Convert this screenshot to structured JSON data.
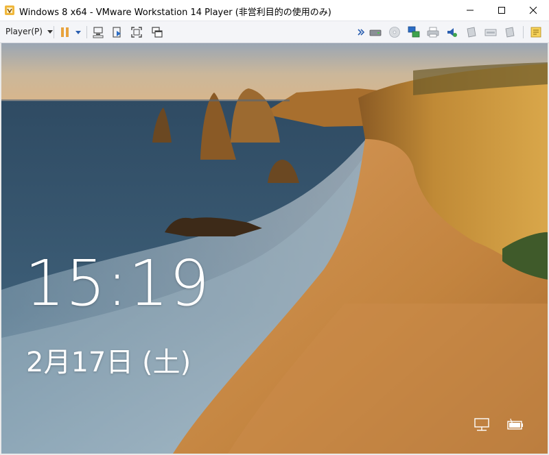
{
  "window": {
    "title": "Windows 8 x64 - VMware Workstation 14 Player (非営利目的の使用のみ)",
    "icon": "vmware-player-icon",
    "controls": [
      "minimize-icon",
      "maximize-icon",
      "close-icon"
    ]
  },
  "toolbar": {
    "player_menu_label": "Player(P)",
    "left_icons": [
      "pause-icon",
      "pause-dropdown-icon",
      "send-ctrl-alt-del-icon",
      "removable-devices-icon",
      "full-screen-icon",
      "unity-icon"
    ],
    "right_icons": [
      "more-chevron-icon",
      "hard-disk-icon",
      "cd-dvd-icon",
      "network-adapter-icon",
      "printer-icon",
      "audio-icon",
      "usb-device-1-icon",
      "usb-device-2-icon",
      "usb-device-3-icon",
      "message-log-icon"
    ]
  },
  "lockscreen": {
    "time": "15:19",
    "date": "2月17日 (土)",
    "status_icons": [
      "network-status-icon",
      "battery-status-icon"
    ]
  },
  "colors": {
    "sky": "#c9b89a",
    "ocean": "#3b5a72",
    "sand": "#c98a4a",
    "cliff": "#b8842f",
    "pause_accent": "#e8a33d",
    "vmware_blue": "#2b6cc4"
  }
}
